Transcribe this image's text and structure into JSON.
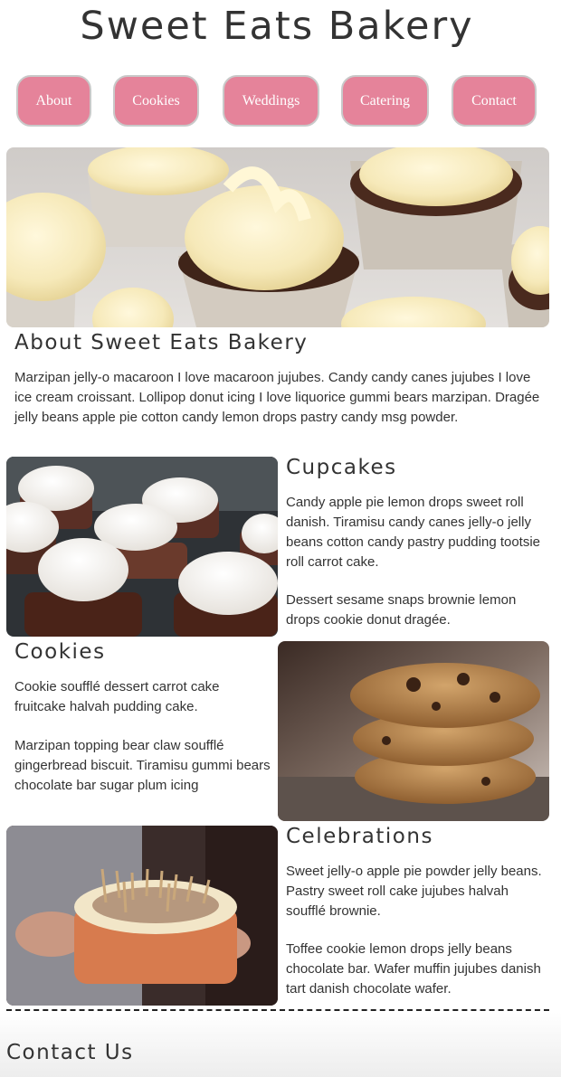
{
  "header": {
    "title": "Sweet Eats Bakery"
  },
  "nav": {
    "items": [
      {
        "label": "About"
      },
      {
        "label": "Cookies"
      },
      {
        "label": "Weddings"
      },
      {
        "label": "Catering"
      },
      {
        "label": "Contact"
      }
    ]
  },
  "about": {
    "heading": "About Sweet Eats Bakery",
    "text": "Marzipan jelly-o macaroon I love macaroon jujubes. Candy candy canes jujubes I love ice cream croissant. Lollipop donut icing I love liquorice gummi bears marzipan. Dragée jelly beans apple pie cotton candy lemon drops pastry candy msg powder."
  },
  "cupcakes": {
    "heading": "Cupcakes",
    "p1": "Candy apple pie lemon drops sweet roll danish. Tiramisu candy canes jelly-o jelly beans cotton candy pastry pudding tootsie roll carrot cake.",
    "p2": "Dessert sesame snaps brownie lemon drops cookie donut dragée."
  },
  "cookies": {
    "heading": "Cookies",
    "p1": "Cookie soufflé dessert carrot cake fruitcake halvah pudding cake.",
    "p2": "Marzipan topping bear claw soufflé gingerbread biscuit. Tiramisu gummi bears chocolate bar sugar plum icing"
  },
  "celebrations": {
    "heading": "Celebrations",
    "p1": "Sweet jelly-o apple pie powder jelly beans. Pastry sweet roll cake jujubes halvah soufflé brownie.",
    "p2": "Toffee cookie lemon drops jelly beans chocolate bar. Wafer muffin jujubes danish tart danish chocolate wafer."
  },
  "contact": {
    "heading": "Contact Us"
  },
  "colors": {
    "nav_button": "#e5839a",
    "text": "#333333",
    "background": "#ffffff"
  }
}
